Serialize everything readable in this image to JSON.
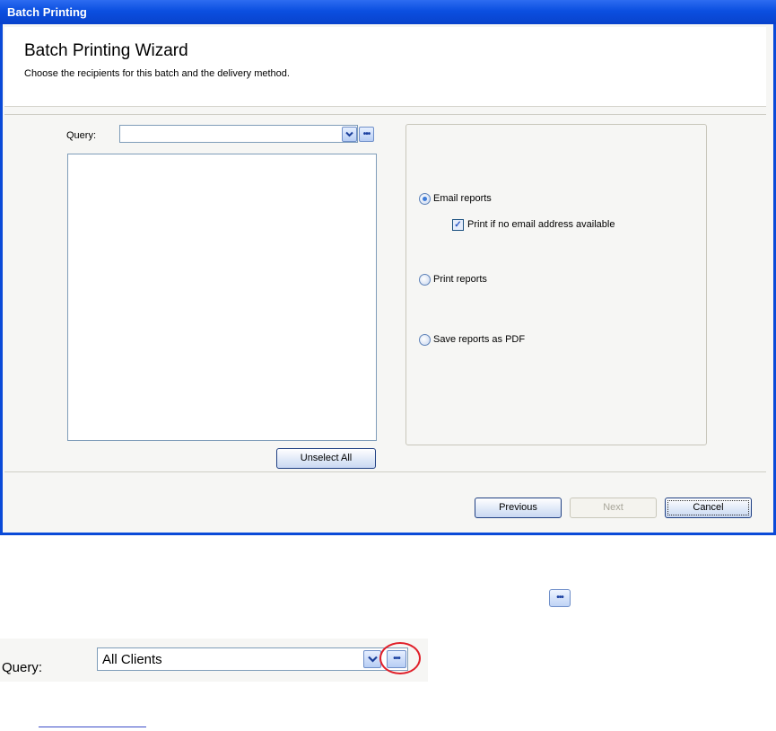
{
  "window": {
    "title": "Batch Printing"
  },
  "header": {
    "title": "Batch Printing Wizard",
    "subtitle": "Choose the recipients for this batch and the delivery method."
  },
  "query": {
    "label": "Query:",
    "value": ""
  },
  "list": {
    "unselect_label": "Unselect All"
  },
  "options": {
    "email_label": "Email reports",
    "email_checked": true,
    "print_if_no_email_label": "Print if no email address available",
    "print_if_no_email_checked": true,
    "print_label": "Print reports",
    "pdf_label": "Save reports as PDF"
  },
  "footer": {
    "previous_label": "Previous",
    "next_label": "Next",
    "cancel_label": "Cancel"
  },
  "annotation": {
    "query_label": "Query:",
    "query_value": "All Clients"
  }
}
